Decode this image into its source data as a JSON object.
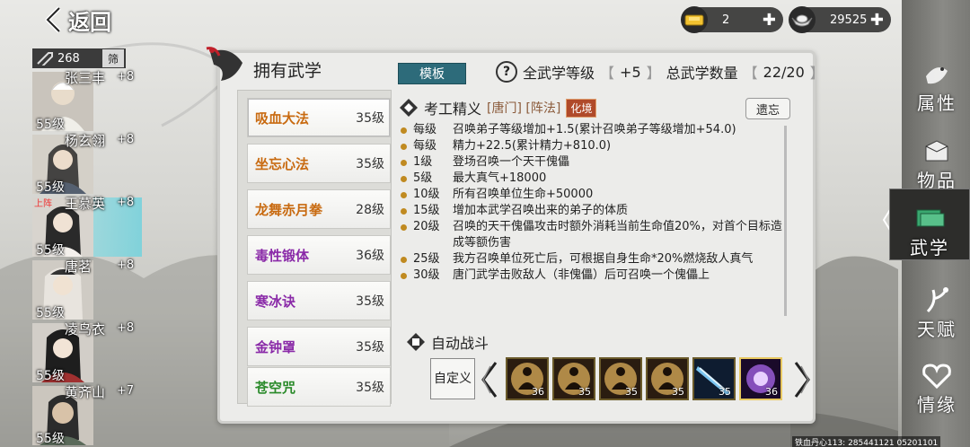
{
  "header": {
    "back_label": "返回"
  },
  "currency": {
    "gold": "2",
    "silver": "29525"
  },
  "roster": {
    "power": "268",
    "filter_label": "筛",
    "heroes": [
      {
        "name": "张三丰",
        "plus": "+8",
        "level": "55级",
        "tag": ""
      },
      {
        "name": "杨玄翎",
        "plus": "+8",
        "level": "55级",
        "tag": ""
      },
      {
        "name": "王慕英",
        "plus": "+8",
        "level": "55级",
        "tag": "上阵"
      },
      {
        "name": "唐茗",
        "plus": "+8",
        "level": "55级",
        "tag": ""
      },
      {
        "name": "凌鸟衣",
        "plus": "+8",
        "level": "55级",
        "tag": ""
      },
      {
        "name": "黄齐山",
        "plus": "+7",
        "level": "55级",
        "tag": ""
      }
    ]
  },
  "panel": {
    "title": "拥有武学",
    "template_btn": "模板",
    "help_icon": "?",
    "stats": {
      "all_level_label": "全武学等级",
      "all_level_value": "+5",
      "total_label": "总武学数量",
      "total_value": "22/20"
    },
    "skills": [
      {
        "name": "吸血大法",
        "level": "35级",
        "color": "#c86a10"
      },
      {
        "name": "坐忘心法",
        "level": "35级",
        "color": "#c86a10"
      },
      {
        "name": "龙舞赤月拳",
        "level": "28级",
        "color": "#c86a10"
      },
      {
        "name": "毒性锻体",
        "level": "36级",
        "color": "#8a2aa8"
      },
      {
        "name": "寒冰诀",
        "level": "35级",
        "color": "#8a2aa8"
      },
      {
        "name": "金钟罩",
        "level": "35级",
        "color": "#8a2aa8"
      },
      {
        "name": "苍空咒",
        "level": "35级",
        "color": "#2a8a2a"
      }
    ],
    "detail": {
      "name": "考工精义",
      "tags": "[唐门] [阵法]",
      "badge": "化境",
      "forget_btn": "遗忘",
      "lines": [
        {
          "lv": "每级",
          "txt": "召唤弟子等级增加+1.5(累计召唤弟子等级增加+54.0)"
        },
        {
          "lv": "每级",
          "txt": "精力+22.5(累计精力+810.0)"
        },
        {
          "lv": "1级",
          "txt": "登场召唤一个天干傀儡"
        },
        {
          "lv": "5级",
          "txt": "最大真气+18000"
        },
        {
          "lv": "10级",
          "txt": "所有召唤单位生命+50000"
        },
        {
          "lv": "15级",
          "txt": "增加本武学召唤出来的弟子的体质"
        },
        {
          "lv": "20级",
          "txt": "召唤的天干傀儡攻击时额外消耗当前生命值20%，对首个目标造成等额伤害"
        },
        {
          "lv": "25级",
          "txt": "我方召唤单位死亡后，可根据自身生命*20%燃烧敌人真气"
        },
        {
          "lv": "30级",
          "txt": "唐门武学击败敌人（非傀儡）后可召唤一个傀儡上"
        }
      ]
    },
    "auto_battle": {
      "label": "自动战斗",
      "custom_btn": "自定义",
      "slots": [
        {
          "icon": "monk-meditate-icon",
          "count": "36"
        },
        {
          "icon": "monk-meditate-icon",
          "count": "35"
        },
        {
          "icon": "monk-meditate-icon",
          "count": "35"
        },
        {
          "icon": "monk-meditate-icon",
          "count": "35"
        },
        {
          "icon": "blade-icon",
          "count": "35"
        },
        {
          "icon": "purple-orb-icon",
          "count": "36"
        }
      ]
    }
  },
  "right_tabs": [
    {
      "label": "属性",
      "icon": "bird-icon"
    },
    {
      "label": "物品",
      "icon": "box-icon"
    },
    {
      "label": "武学",
      "icon": "book-icon"
    },
    {
      "label": "天赋",
      "icon": "branch-icon"
    },
    {
      "label": "情缘",
      "icon": "heart-icon"
    }
  ],
  "footer": {
    "id_text": "铁血丹心113: 285441121 05201101"
  },
  "colors": {
    "accent_teal": "#2d6b7a",
    "gold": "#e8c860"
  }
}
